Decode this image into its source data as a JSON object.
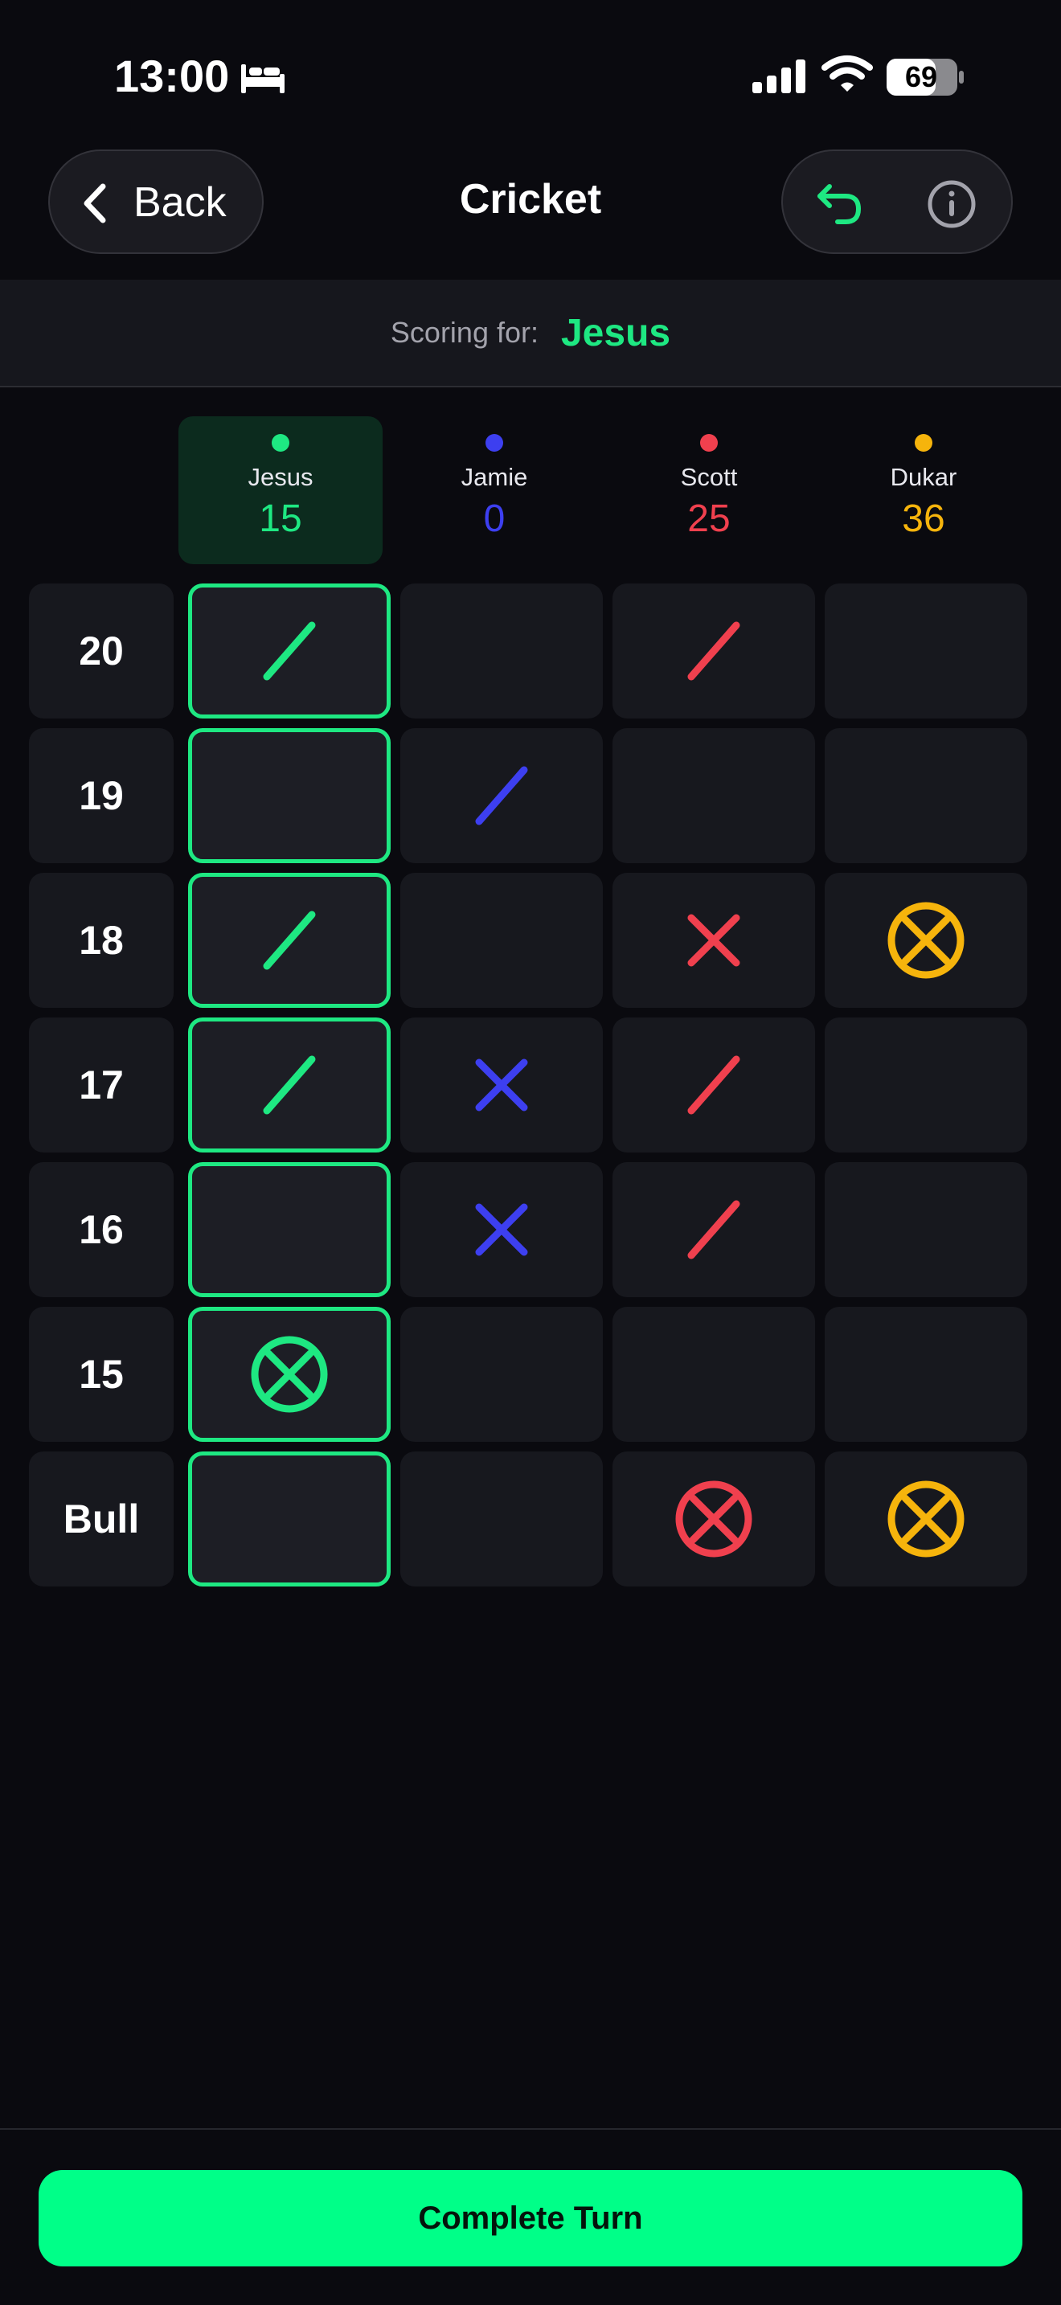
{
  "status_bar": {
    "time": "13:00",
    "battery": "69"
  },
  "header": {
    "back_label": "Back",
    "title": "Cricket"
  },
  "scoring": {
    "label": "Scoring for:",
    "player": "Jesus"
  },
  "players": [
    {
      "name": "Jesus",
      "score": "15",
      "color": "#1ee882",
      "active": true
    },
    {
      "name": "Jamie",
      "score": "0",
      "color": "#3d3ff0",
      "active": false
    },
    {
      "name": "Scott",
      "score": "25",
      "color": "#f0404e",
      "active": false
    },
    {
      "name": "Dukar",
      "score": "36",
      "color": "#f6b40c",
      "active": false
    }
  ],
  "board": [
    {
      "number": "20",
      "marks": [
        1,
        0,
        1,
        0
      ]
    },
    {
      "number": "19",
      "marks": [
        0,
        1,
        0,
        0
      ]
    },
    {
      "number": "18",
      "marks": [
        1,
        0,
        2,
        3
      ]
    },
    {
      "number": "17",
      "marks": [
        1,
        2,
        1,
        0
      ]
    },
    {
      "number": "16",
      "marks": [
        0,
        2,
        1,
        0
      ]
    },
    {
      "number": "15",
      "marks": [
        3,
        0,
        0,
        0
      ]
    },
    {
      "number": "Bull",
      "marks": [
        0,
        0,
        3,
        3
      ]
    }
  ],
  "footer": {
    "complete_turn_label": "Complete Turn"
  }
}
